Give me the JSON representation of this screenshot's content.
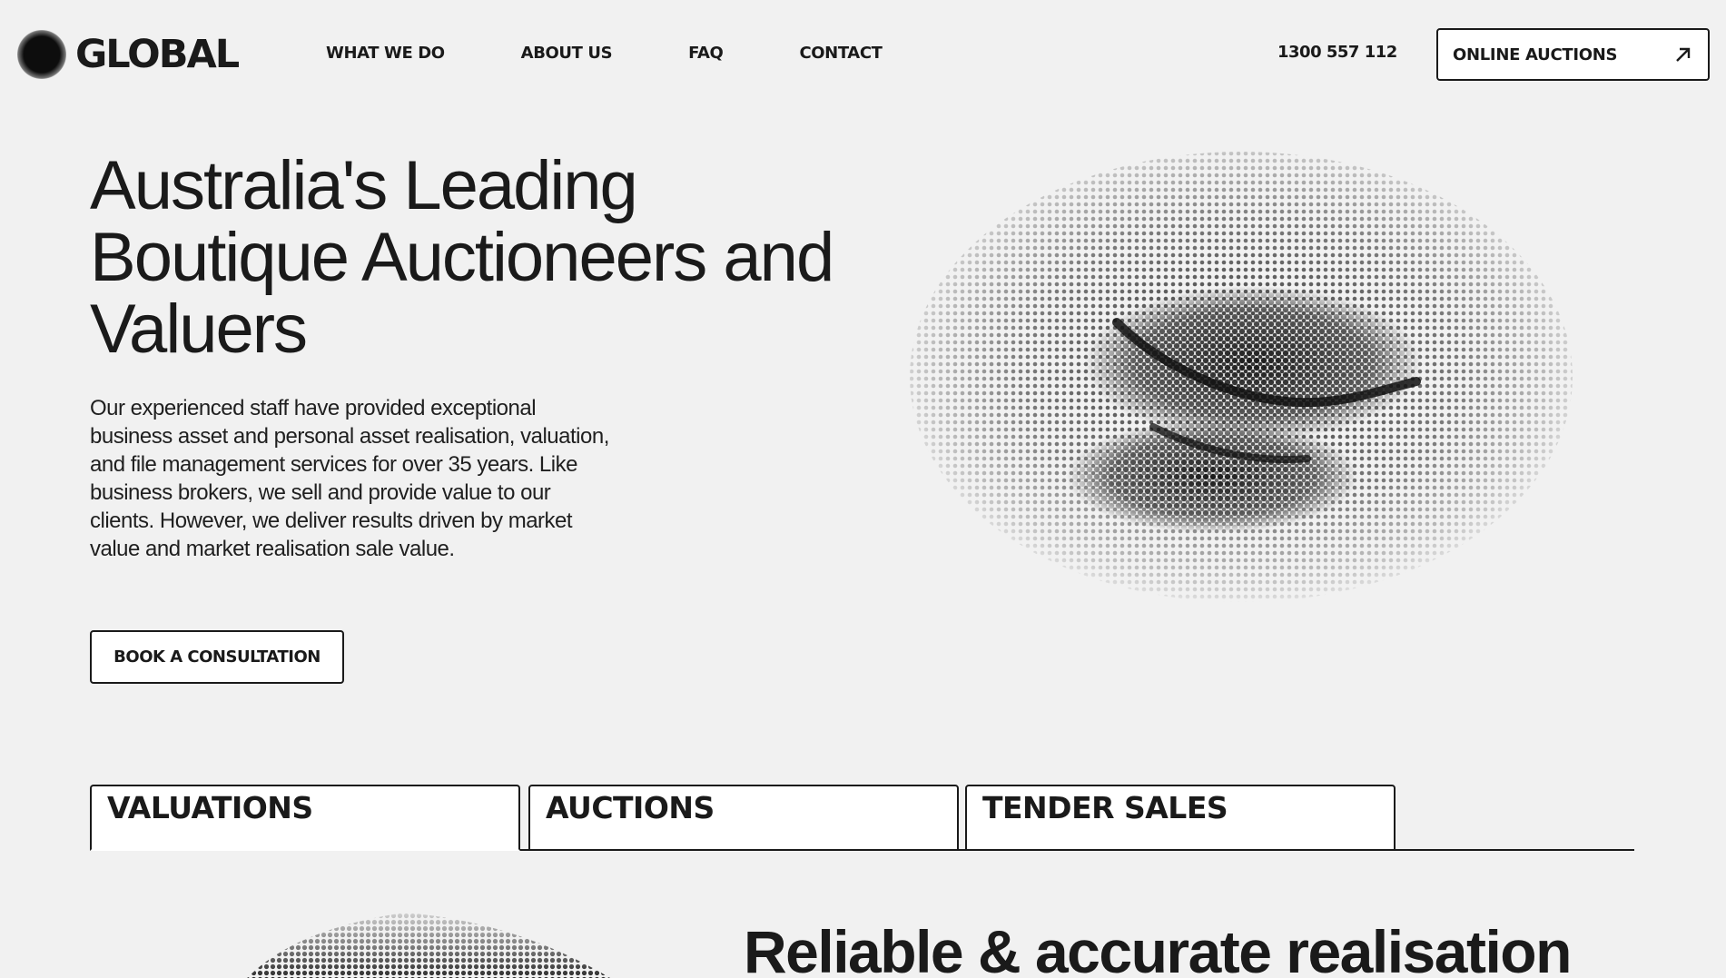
{
  "header": {
    "logo_text": "GLOBAL",
    "nav": [
      {
        "label": "WHAT WE DO"
      },
      {
        "label": "ABOUT US"
      },
      {
        "label": "FAQ"
      },
      {
        "label": "CONTACT"
      }
    ],
    "phone": "1300 557 112",
    "online_auctions_label": "ONLINE AUCTIONS",
    "online_auctions_icon": "arrow-up-right-icon"
  },
  "hero": {
    "title_line1": "Australia's Leading",
    "title_line2": "Boutique Auctioneers and",
    "title_line3": "Valuers",
    "description": "Our experienced staff have provided exceptional business asset and personal asset realisation, valuation, and file management services for over 35 years. Like business brokers, we sell and provide value to our clients. However, we deliver results driven by market value and market realisation sale value.",
    "cta_label": "BOOK A CONSULTATION"
  },
  "tabs": [
    {
      "label": "VALUATIONS",
      "active": true
    },
    {
      "label": "AUCTIONS",
      "active": false
    },
    {
      "label": "TENDER SALES",
      "active": false
    }
  ],
  "section": {
    "heading": "Reliable & accurate realisation"
  },
  "colors": {
    "background": "#f1f1f1",
    "text": "#1a1a1a",
    "button_bg": "#ffffff"
  }
}
